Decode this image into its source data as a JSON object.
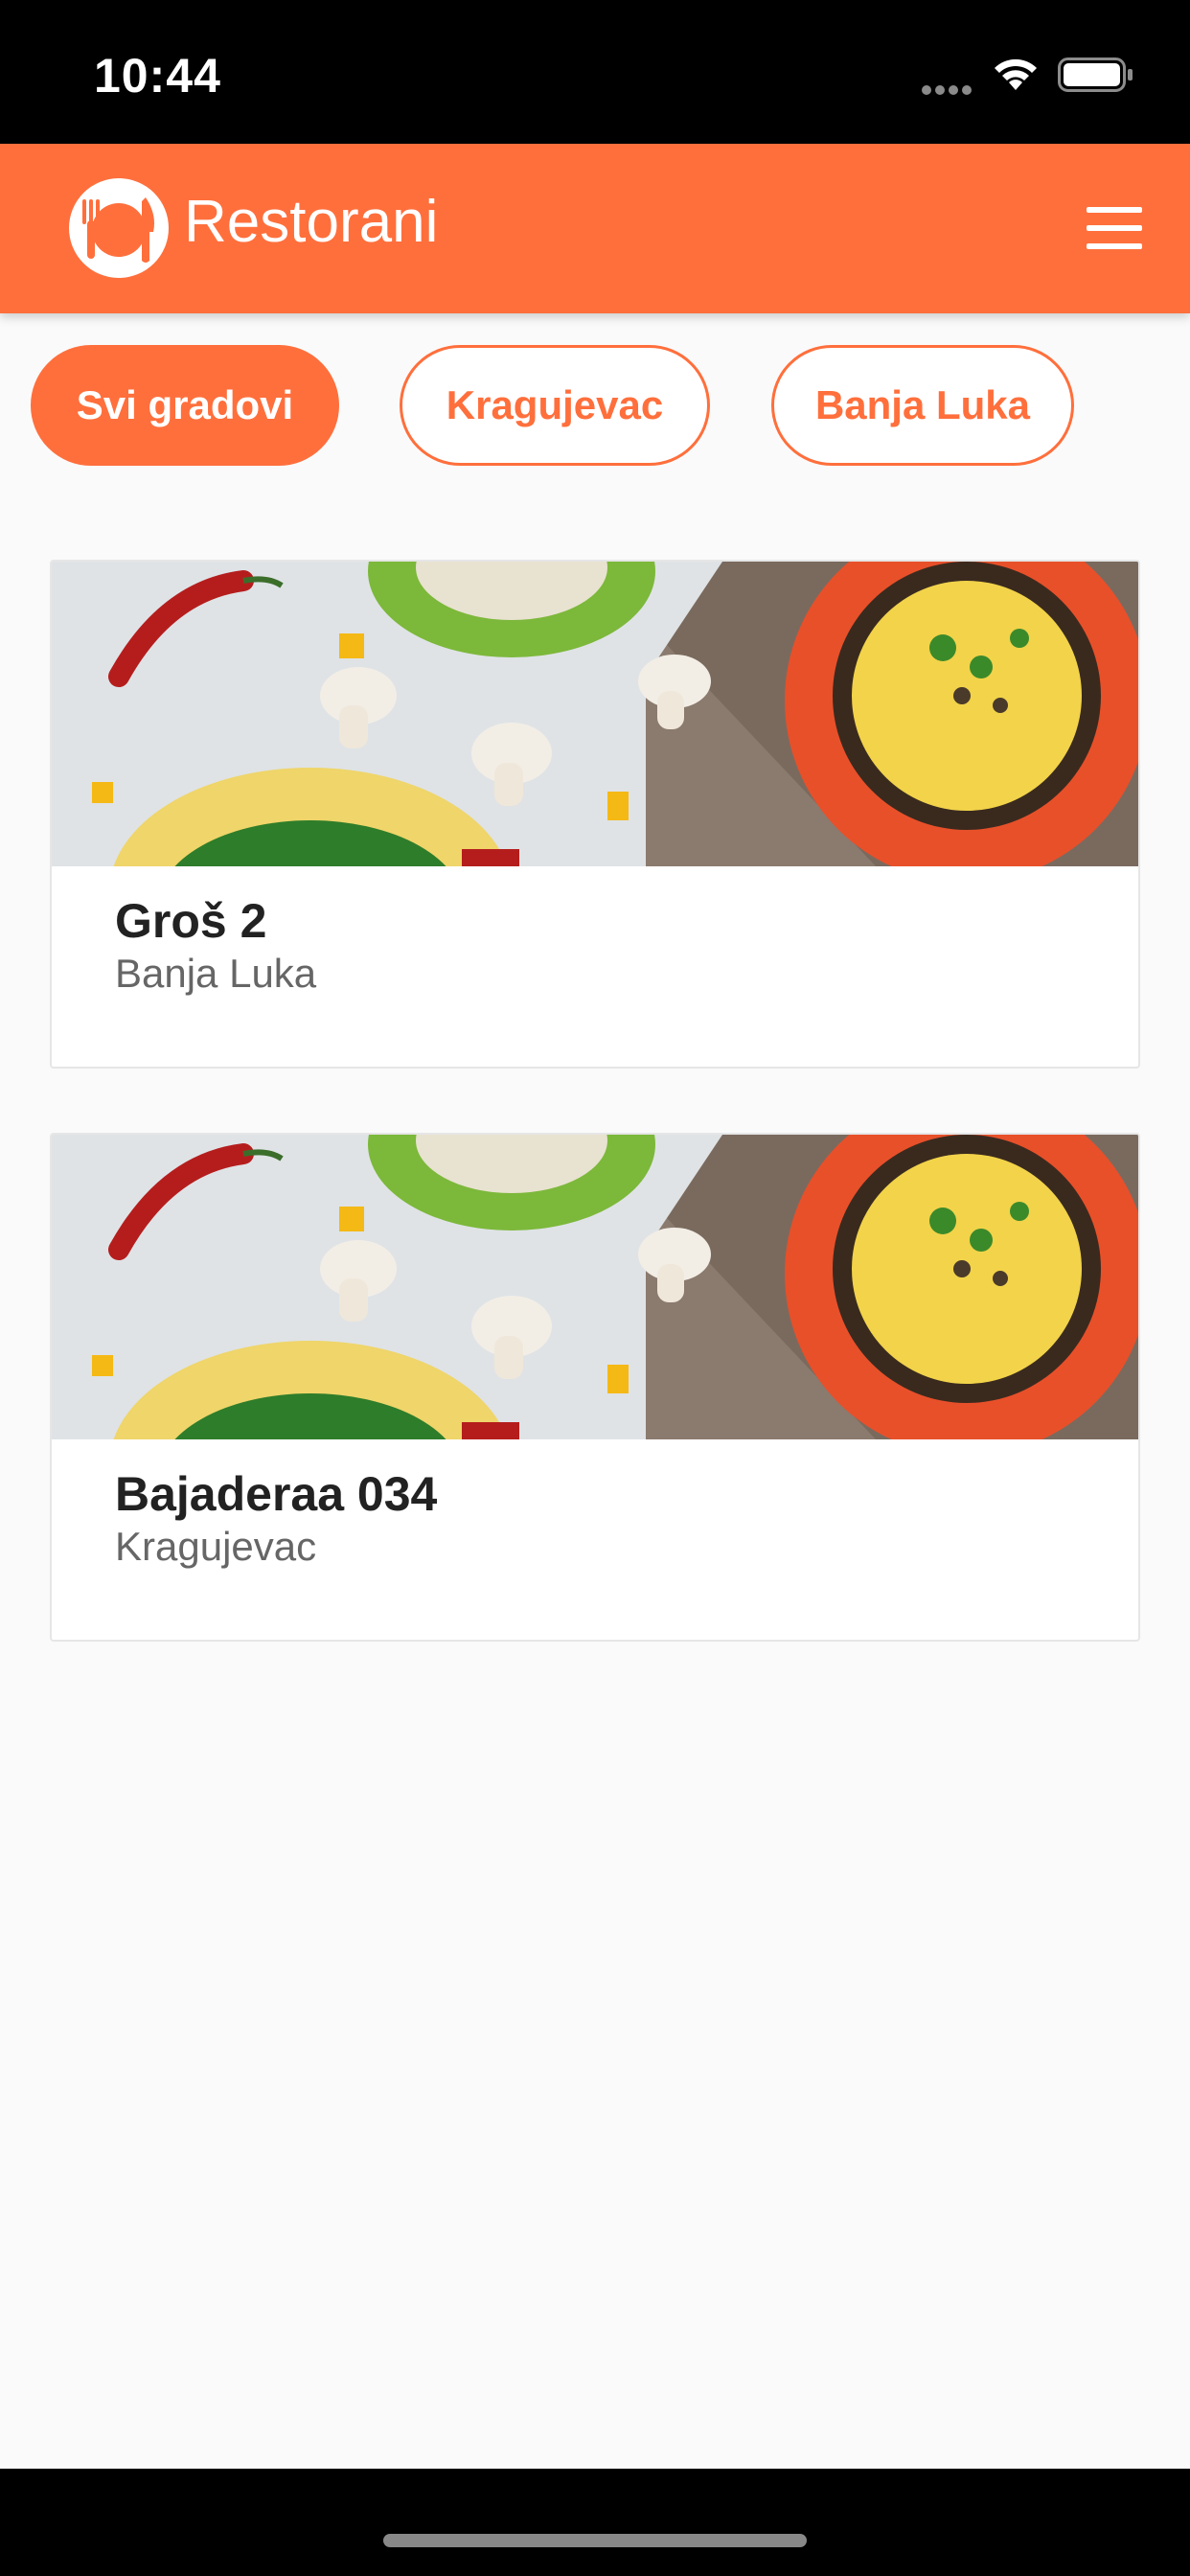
{
  "status_bar": {
    "time": "10:44"
  },
  "app_bar": {
    "title": "Restorani",
    "logo_icon": "plate-fork-knife-icon",
    "menu_icon": "hamburger-menu-icon"
  },
  "filters": {
    "chips": [
      {
        "label": "Svi gradovi",
        "active": true
      },
      {
        "label": "Kragujevac",
        "active": false
      },
      {
        "label": "Banja Luka",
        "active": false
      }
    ]
  },
  "restaurants": [
    {
      "name": "Groš 2",
      "city": "Banja Luka",
      "image": "food-photo"
    },
    {
      "name": "Bajaderaa 034",
      "city": "Kragujevac",
      "image": "food-photo"
    }
  ],
  "colors": {
    "accent": "#ff6f3c",
    "background": "#fafafa",
    "status_bar": "#000000"
  }
}
